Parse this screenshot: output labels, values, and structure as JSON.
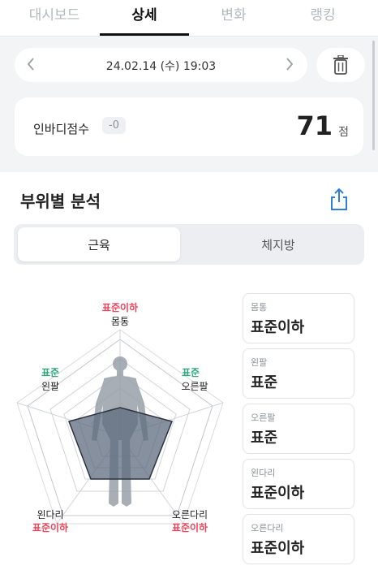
{
  "tabs": [
    {
      "label": "대시보드"
    },
    {
      "label": "상세"
    },
    {
      "label": "변화"
    },
    {
      "label": "랭킹"
    }
  ],
  "date": {
    "text": "24.02.14 (수) 19:03"
  },
  "score": {
    "label": "인바디점수",
    "delta": "-0",
    "value": "71",
    "unit": "점"
  },
  "analysis": {
    "title": "부위별 분석",
    "segments": {
      "muscle": "근육",
      "fat": "체지방"
    },
    "radar": {
      "trunk": {
        "part": "몸통",
        "status": "표준이하"
      },
      "left_arm": {
        "part": "왼팔",
        "status": "표준"
      },
      "right_arm": {
        "part": "오른팔",
        "status": "표준"
      },
      "left_leg": {
        "part": "왼다리",
        "status": "표준이하"
      },
      "right_leg": {
        "part": "오른다리",
        "status": "표준이하"
      }
    },
    "cards": [
      {
        "part": "몸통",
        "status": "표준이하"
      },
      {
        "part": "왼팔",
        "status": "표준"
      },
      {
        "part": "오른팔",
        "status": "표준"
      },
      {
        "part": "왼다리",
        "status": "표준이하"
      },
      {
        "part": "오른다리",
        "status": "표준이하"
      }
    ]
  },
  "colors": {
    "below": "#e8455a",
    "standard": "#2fa87a",
    "fill": "#5e6b7e"
  },
  "icons": {
    "prev": "chevron-left-icon",
    "next": "chevron-right-icon",
    "trash": "trash-icon",
    "share": "share-icon",
    "body": "body-silhouette-icon"
  }
}
